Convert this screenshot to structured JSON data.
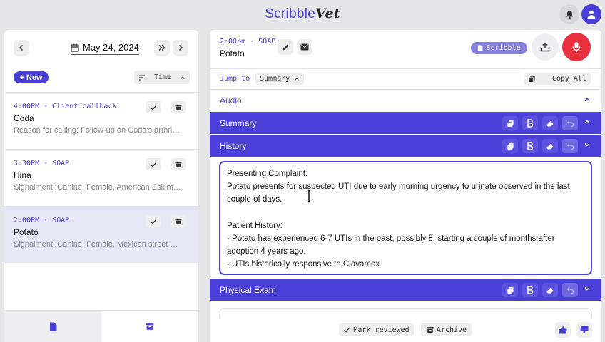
{
  "app": {
    "logo_part1": "Scribble",
    "logo_part2": "Vet"
  },
  "colors": {
    "accent": "#4a3fd6",
    "record": "#e8303e",
    "selected_row": "#e8e7f8"
  },
  "left": {
    "date": "May 24, 2024",
    "new_label": "New",
    "sort_label": "Time",
    "appointments": [
      {
        "time": "4:00PM · Client callback",
        "name": "Coda",
        "desc": "Reason for calling: Follow-up on Coda's arthri…",
        "selected": false
      },
      {
        "time": "3:30PM · SOAP",
        "name": "Hina",
        "desc": "Signalment: Canine, Female, American Eskim…",
        "selected": false
      },
      {
        "time": "2:00PM · SOAP",
        "name": "Potato",
        "desc": "Signalment: Canine, Female, Mexican street …",
        "selected": true
      }
    ]
  },
  "right": {
    "header_time": "2:00pm · SOAP",
    "header_name": "Potato",
    "scribble_label": "Scribble",
    "jump_label": "Jump to",
    "jump_value": "Summary",
    "copy_all_label": "Copy All",
    "sections": {
      "audio": "Audio",
      "summary": "Summary",
      "history": "History",
      "physical_exam": "Physical Exam"
    },
    "history_text": [
      "Presenting Complaint:",
      "Potato presents for suspected UTI due to early morning urgency to urinate observed in the last couple of days.",
      "",
      "Patient History:",
      "- Potato has experienced 6-7 UTIs in the past, possibly 8, starting a couple of months after adoption 4 years ago.",
      "- UTIs historically responsive to Clavamox."
    ],
    "footer": {
      "mark_reviewed": "Mark reviewed",
      "archive": "Archive"
    }
  }
}
